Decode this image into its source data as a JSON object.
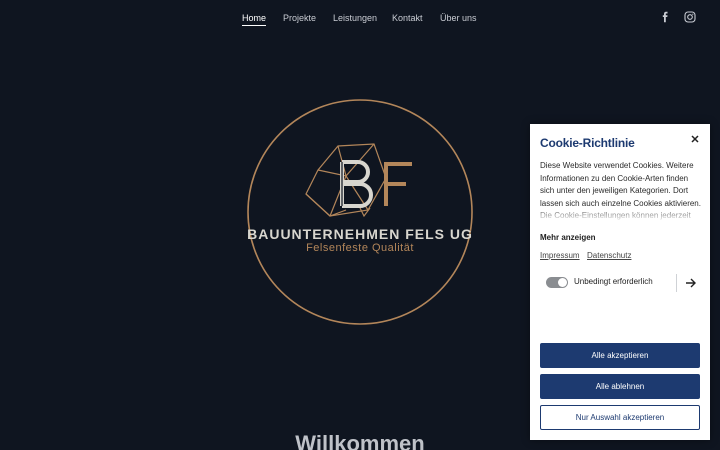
{
  "nav": {
    "items": [
      "Home",
      "Projekte",
      "Leistungen",
      "Kontakt",
      "Über uns"
    ],
    "active": "Home"
  },
  "social": {
    "icons": [
      "facebook-icon",
      "instagram-icon"
    ]
  },
  "logo": {
    "monogram": "BF",
    "name": "BAUUNTERNEHMEN FELS UG",
    "tagline": "Felsenfeste Qualität"
  },
  "welcome": "Willkommen",
  "cookie": {
    "title": "Cookie-Richtlinie",
    "description": "Diese Website verwendet Cookies. Weitere Informationen zu den Cookie-Arten finden sich unter den jeweiligen Kategorien. Dort lassen sich auch einzelne Cookies aktivieren. Die Cookie-Einstellungen können jederzeit",
    "more": "Mehr anzeigen",
    "links": [
      "Impressum",
      "Datenschutz"
    ],
    "category": "Unbedingt erforderlich",
    "buttons": {
      "accept_all": "Alle akzeptieren",
      "reject_all": "Alle ablehnen",
      "accept_selection": "Nur Auswahl akzeptieren"
    }
  },
  "colors": {
    "background": "#0f1520",
    "brand_gold": "#b3865a",
    "brand_navy": "#1d3a70"
  }
}
